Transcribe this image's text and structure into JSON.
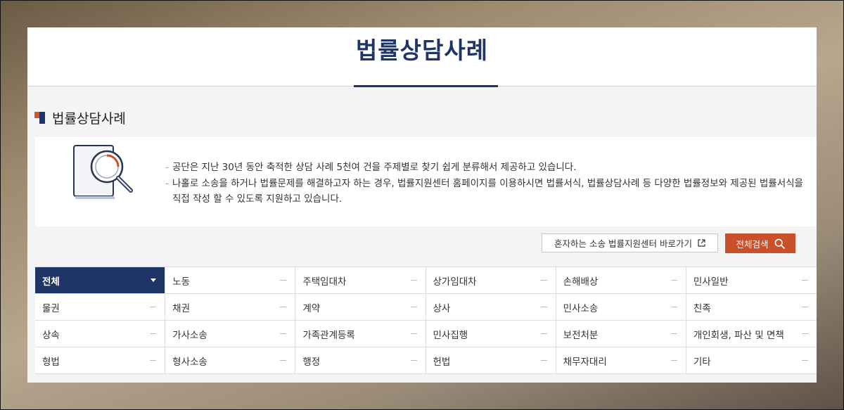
{
  "hero": {
    "title": "법률상담사례"
  },
  "section": {
    "title": "법률상담사례"
  },
  "info": {
    "icon": "magnifier-document-icon",
    "lines": [
      "공단은 지난 30년 동안 축적한 상담 사례 5천여 건을 주제별로 찾기 쉽게 분류해서 제공하고 있습니다.",
      "나홀로 소송을 하거나 법률문제를 해결하고자 하는 경우, 법률지원센터 홈페이지를 이용하시면 법률서식, 법률상담사례 등 다양한 법률정보와 제공된 법률서식을 직접 작성 할 수 있도록 지원하고 있습니다."
    ]
  },
  "actions": {
    "link_label": "혼자하는 소송 법률지원센터 바로가기",
    "search_label": "전체검색"
  },
  "colors": {
    "navy": "#1f3467",
    "accent": "#c9502a"
  },
  "categories": [
    {
      "label": "전체",
      "active": true
    },
    {
      "label": "노동"
    },
    {
      "label": "주택임대차"
    },
    {
      "label": "상가임대차"
    },
    {
      "label": "손해배상"
    },
    {
      "label": "민사일반"
    },
    {
      "label": "물권"
    },
    {
      "label": "채권"
    },
    {
      "label": "계약"
    },
    {
      "label": "상사"
    },
    {
      "label": "민사소송"
    },
    {
      "label": "친족"
    },
    {
      "label": "상속"
    },
    {
      "label": "가사소송"
    },
    {
      "label": "가족관계등록"
    },
    {
      "label": "민사집행"
    },
    {
      "label": "보전처분"
    },
    {
      "label": "개인회생, 파산 및 면책"
    },
    {
      "label": "형법"
    },
    {
      "label": "형사소송"
    },
    {
      "label": "행정"
    },
    {
      "label": "헌법"
    },
    {
      "label": "채무자대리"
    },
    {
      "label": "기타"
    }
  ]
}
